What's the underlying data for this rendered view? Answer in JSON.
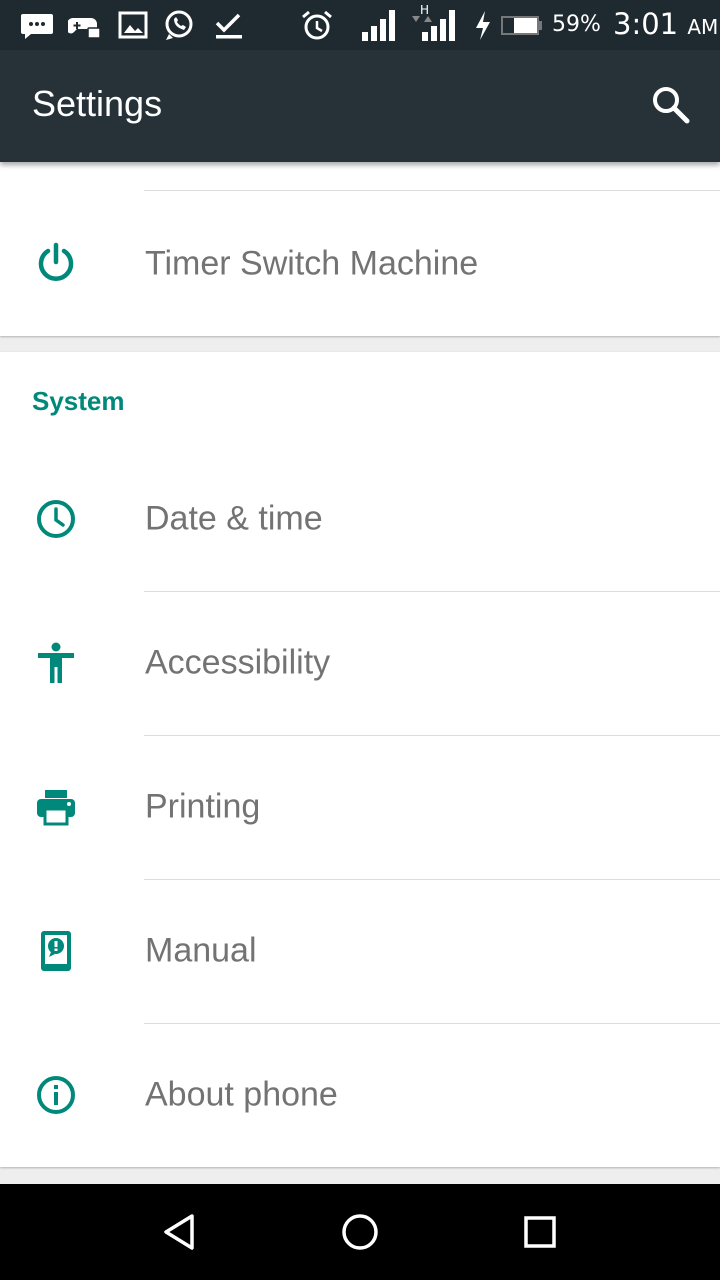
{
  "status_bar": {
    "icons": [
      "message-icon",
      "game-controller-icon",
      "image-icon",
      "whatsapp-icon",
      "download-done-icon",
      "alarm-icon",
      "signal-icon",
      "signal-h-icon",
      "charging-icon",
      "battery-icon"
    ],
    "battery_percent": "59%",
    "time": "3:01",
    "time_suffix": "AM"
  },
  "app_bar": {
    "title": "Settings",
    "background": "#263238"
  },
  "accent_color": "#00897b",
  "card_top": {
    "items": [
      {
        "label": "Timer Switch Machine",
        "icon": "power-icon"
      }
    ]
  },
  "system_section": {
    "header": "System",
    "items": [
      {
        "label": "Date & time",
        "icon": "clock-icon"
      },
      {
        "label": "Accessibility",
        "icon": "accessibility-icon"
      },
      {
        "label": "Printing",
        "icon": "printer-icon"
      },
      {
        "label": "Manual",
        "icon": "manual-icon"
      },
      {
        "label": "About phone",
        "icon": "info-icon"
      }
    ]
  },
  "nav_bar": {
    "buttons": [
      "back-icon",
      "home-icon",
      "recents-icon"
    ]
  }
}
